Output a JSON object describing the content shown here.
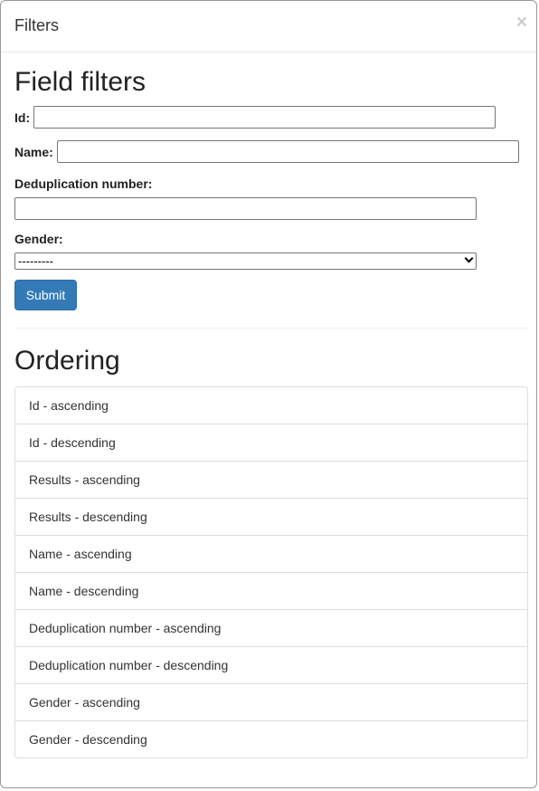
{
  "modal": {
    "title": "Filters",
    "close_label": "×"
  },
  "field_filters": {
    "heading": "Field filters",
    "id_label": "Id:",
    "id_value": "",
    "name_label": "Name:",
    "name_value": "",
    "dedup_label": "Deduplication number:",
    "dedup_value": "",
    "gender_label": "Gender:",
    "gender_selected": "---------",
    "submit_label": "Submit"
  },
  "ordering": {
    "heading": "Ordering",
    "items": [
      {
        "label": "Id - ascending"
      },
      {
        "label": "Id - descending"
      },
      {
        "label": "Results - ascending"
      },
      {
        "label": "Results - descending"
      },
      {
        "label": "Name - ascending"
      },
      {
        "label": "Name - descending"
      },
      {
        "label": "Deduplication number - ascending"
      },
      {
        "label": "Deduplication number - descending"
      },
      {
        "label": "Gender - ascending"
      },
      {
        "label": "Gender - descending"
      }
    ]
  },
  "colors": {
    "primary": "#337ab7",
    "border": "#dddddd"
  }
}
